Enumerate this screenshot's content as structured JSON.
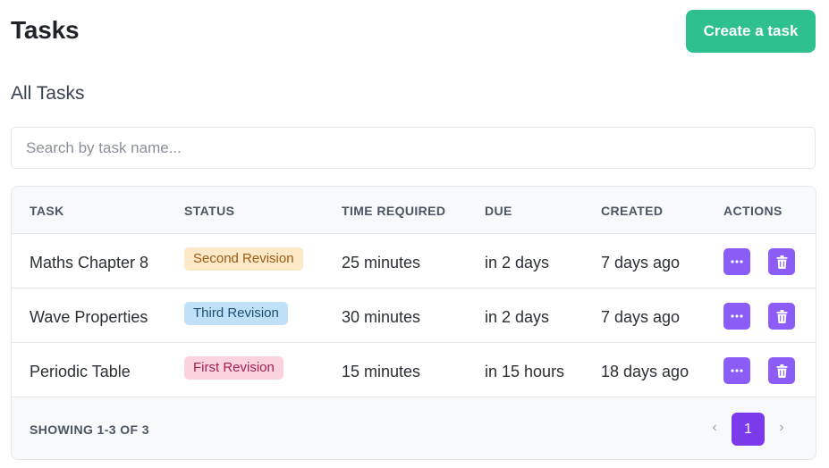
{
  "header": {
    "title": "Tasks",
    "create_label": "Create a task",
    "accent": "#2ec08e"
  },
  "section": {
    "title": "All Tasks"
  },
  "search": {
    "placeholder": "Search by task name...",
    "value": ""
  },
  "table": {
    "columns": [
      "TASK",
      "STATUS",
      "TIME REQUIRED",
      "DUE",
      "CREATED",
      "ACTIONS"
    ],
    "rows": [
      {
        "task": "Maths Chapter 8",
        "status": "Second Revision",
        "status_bg": "#fde8c8",
        "status_fg": "#9a5a13",
        "time": "25 minutes",
        "due": "in 2 days",
        "created": "7 days ago"
      },
      {
        "task": "Wave Properties",
        "status": "Third Revision",
        "status_bg": "#bfe0f7",
        "status_fg": "#1e4f73",
        "time": "30 minutes",
        "due": "in 2 days",
        "created": "7 days ago"
      },
      {
        "task": "Periodic Table",
        "status": "First Revision",
        "status_bg": "#fbd3df",
        "status_fg": "#a3224e",
        "time": "15 minutes",
        "due": "in 15 hours",
        "created": "18 days ago"
      }
    ],
    "action_icons": [
      "more-icon",
      "trash-icon"
    ],
    "action_color": "#8b5cf6"
  },
  "footer": {
    "showing": "SHOWING 1-3 OF 3",
    "prev": "‹",
    "next": "›",
    "current_page": "1",
    "page_color": "#7c3aed"
  }
}
